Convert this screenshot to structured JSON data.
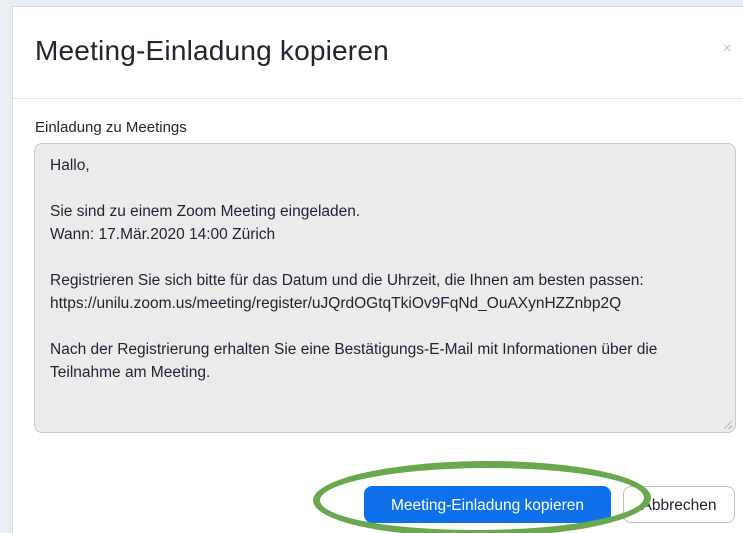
{
  "dialog": {
    "title": "Meeting-Einladung kopieren",
    "close_glyph": "×"
  },
  "invitation": {
    "label": "Einladung zu Meetings",
    "lines": [
      "Hallo,",
      "",
      "Sie sind zu einem Zoom Meeting eingeladen.",
      "Wann: 17.Mär.2020 14:00 Zürich",
      "",
      "Registrieren Sie sich bitte für das Datum und die Uhrzeit, die Ihnen am besten passen:",
      "https://unilu.zoom.us/meeting/register/uJQrdOGtqTkiOv9FqNd_OuAXynHZZnbp2Q",
      "",
      "Nach der Registrierung erhalten Sie eine Bestätigungs-E-Mail mit Informationen über die",
      "Teilnahme am Meeting."
    ]
  },
  "buttons": {
    "copy_label": "Meeting-Einladung kopieren",
    "cancel_label": "Abbrechen"
  },
  "colors": {
    "primary_button": "#0e71eb",
    "highlight": "#6aa84f",
    "textarea_bg": "#ebebeb"
  },
  "icons": {
    "close": "close-icon",
    "resize": "resize-grip-icon"
  }
}
